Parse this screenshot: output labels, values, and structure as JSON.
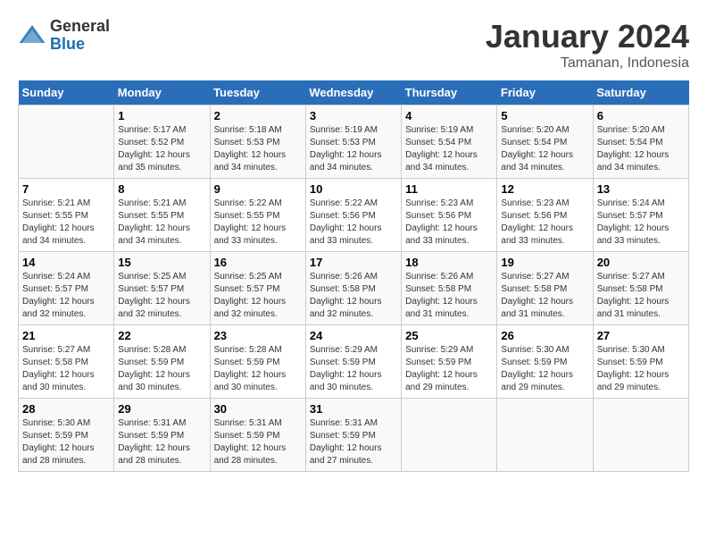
{
  "logo": {
    "general": "General",
    "blue": "Blue"
  },
  "title": "January 2024",
  "subtitle": "Tamanan, Indonesia",
  "days_of_week": [
    "Sunday",
    "Monday",
    "Tuesday",
    "Wednesday",
    "Thursday",
    "Friday",
    "Saturday"
  ],
  "weeks": [
    [
      {
        "day": "",
        "info": ""
      },
      {
        "day": "1",
        "info": "Sunrise: 5:17 AM\nSunset: 5:52 PM\nDaylight: 12 hours\nand 35 minutes."
      },
      {
        "day": "2",
        "info": "Sunrise: 5:18 AM\nSunset: 5:53 PM\nDaylight: 12 hours\nand 34 minutes."
      },
      {
        "day": "3",
        "info": "Sunrise: 5:19 AM\nSunset: 5:53 PM\nDaylight: 12 hours\nand 34 minutes."
      },
      {
        "day": "4",
        "info": "Sunrise: 5:19 AM\nSunset: 5:54 PM\nDaylight: 12 hours\nand 34 minutes."
      },
      {
        "day": "5",
        "info": "Sunrise: 5:20 AM\nSunset: 5:54 PM\nDaylight: 12 hours\nand 34 minutes."
      },
      {
        "day": "6",
        "info": "Sunrise: 5:20 AM\nSunset: 5:54 PM\nDaylight: 12 hours\nand 34 minutes."
      }
    ],
    [
      {
        "day": "7",
        "info": "Sunrise: 5:21 AM\nSunset: 5:55 PM\nDaylight: 12 hours\nand 34 minutes."
      },
      {
        "day": "8",
        "info": "Sunrise: 5:21 AM\nSunset: 5:55 PM\nDaylight: 12 hours\nand 34 minutes."
      },
      {
        "day": "9",
        "info": "Sunrise: 5:22 AM\nSunset: 5:55 PM\nDaylight: 12 hours\nand 33 minutes."
      },
      {
        "day": "10",
        "info": "Sunrise: 5:22 AM\nSunset: 5:56 PM\nDaylight: 12 hours\nand 33 minutes."
      },
      {
        "day": "11",
        "info": "Sunrise: 5:23 AM\nSunset: 5:56 PM\nDaylight: 12 hours\nand 33 minutes."
      },
      {
        "day": "12",
        "info": "Sunrise: 5:23 AM\nSunset: 5:56 PM\nDaylight: 12 hours\nand 33 minutes."
      },
      {
        "day": "13",
        "info": "Sunrise: 5:24 AM\nSunset: 5:57 PM\nDaylight: 12 hours\nand 33 minutes."
      }
    ],
    [
      {
        "day": "14",
        "info": "Sunrise: 5:24 AM\nSunset: 5:57 PM\nDaylight: 12 hours\nand 32 minutes."
      },
      {
        "day": "15",
        "info": "Sunrise: 5:25 AM\nSunset: 5:57 PM\nDaylight: 12 hours\nand 32 minutes."
      },
      {
        "day": "16",
        "info": "Sunrise: 5:25 AM\nSunset: 5:57 PM\nDaylight: 12 hours\nand 32 minutes."
      },
      {
        "day": "17",
        "info": "Sunrise: 5:26 AM\nSunset: 5:58 PM\nDaylight: 12 hours\nand 32 minutes."
      },
      {
        "day": "18",
        "info": "Sunrise: 5:26 AM\nSunset: 5:58 PM\nDaylight: 12 hours\nand 31 minutes."
      },
      {
        "day": "19",
        "info": "Sunrise: 5:27 AM\nSunset: 5:58 PM\nDaylight: 12 hours\nand 31 minutes."
      },
      {
        "day": "20",
        "info": "Sunrise: 5:27 AM\nSunset: 5:58 PM\nDaylight: 12 hours\nand 31 minutes."
      }
    ],
    [
      {
        "day": "21",
        "info": "Sunrise: 5:27 AM\nSunset: 5:58 PM\nDaylight: 12 hours\nand 30 minutes."
      },
      {
        "day": "22",
        "info": "Sunrise: 5:28 AM\nSunset: 5:59 PM\nDaylight: 12 hours\nand 30 minutes."
      },
      {
        "day": "23",
        "info": "Sunrise: 5:28 AM\nSunset: 5:59 PM\nDaylight: 12 hours\nand 30 minutes."
      },
      {
        "day": "24",
        "info": "Sunrise: 5:29 AM\nSunset: 5:59 PM\nDaylight: 12 hours\nand 30 minutes."
      },
      {
        "day": "25",
        "info": "Sunrise: 5:29 AM\nSunset: 5:59 PM\nDaylight: 12 hours\nand 29 minutes."
      },
      {
        "day": "26",
        "info": "Sunrise: 5:30 AM\nSunset: 5:59 PM\nDaylight: 12 hours\nand 29 minutes."
      },
      {
        "day": "27",
        "info": "Sunrise: 5:30 AM\nSunset: 5:59 PM\nDaylight: 12 hours\nand 29 minutes."
      }
    ],
    [
      {
        "day": "28",
        "info": "Sunrise: 5:30 AM\nSunset: 5:59 PM\nDaylight: 12 hours\nand 28 minutes."
      },
      {
        "day": "29",
        "info": "Sunrise: 5:31 AM\nSunset: 5:59 PM\nDaylight: 12 hours\nand 28 minutes."
      },
      {
        "day": "30",
        "info": "Sunrise: 5:31 AM\nSunset: 5:59 PM\nDaylight: 12 hours\nand 28 minutes."
      },
      {
        "day": "31",
        "info": "Sunrise: 5:31 AM\nSunset: 5:59 PM\nDaylight: 12 hours\nand 27 minutes."
      },
      {
        "day": "",
        "info": ""
      },
      {
        "day": "",
        "info": ""
      },
      {
        "day": "",
        "info": ""
      }
    ]
  ]
}
